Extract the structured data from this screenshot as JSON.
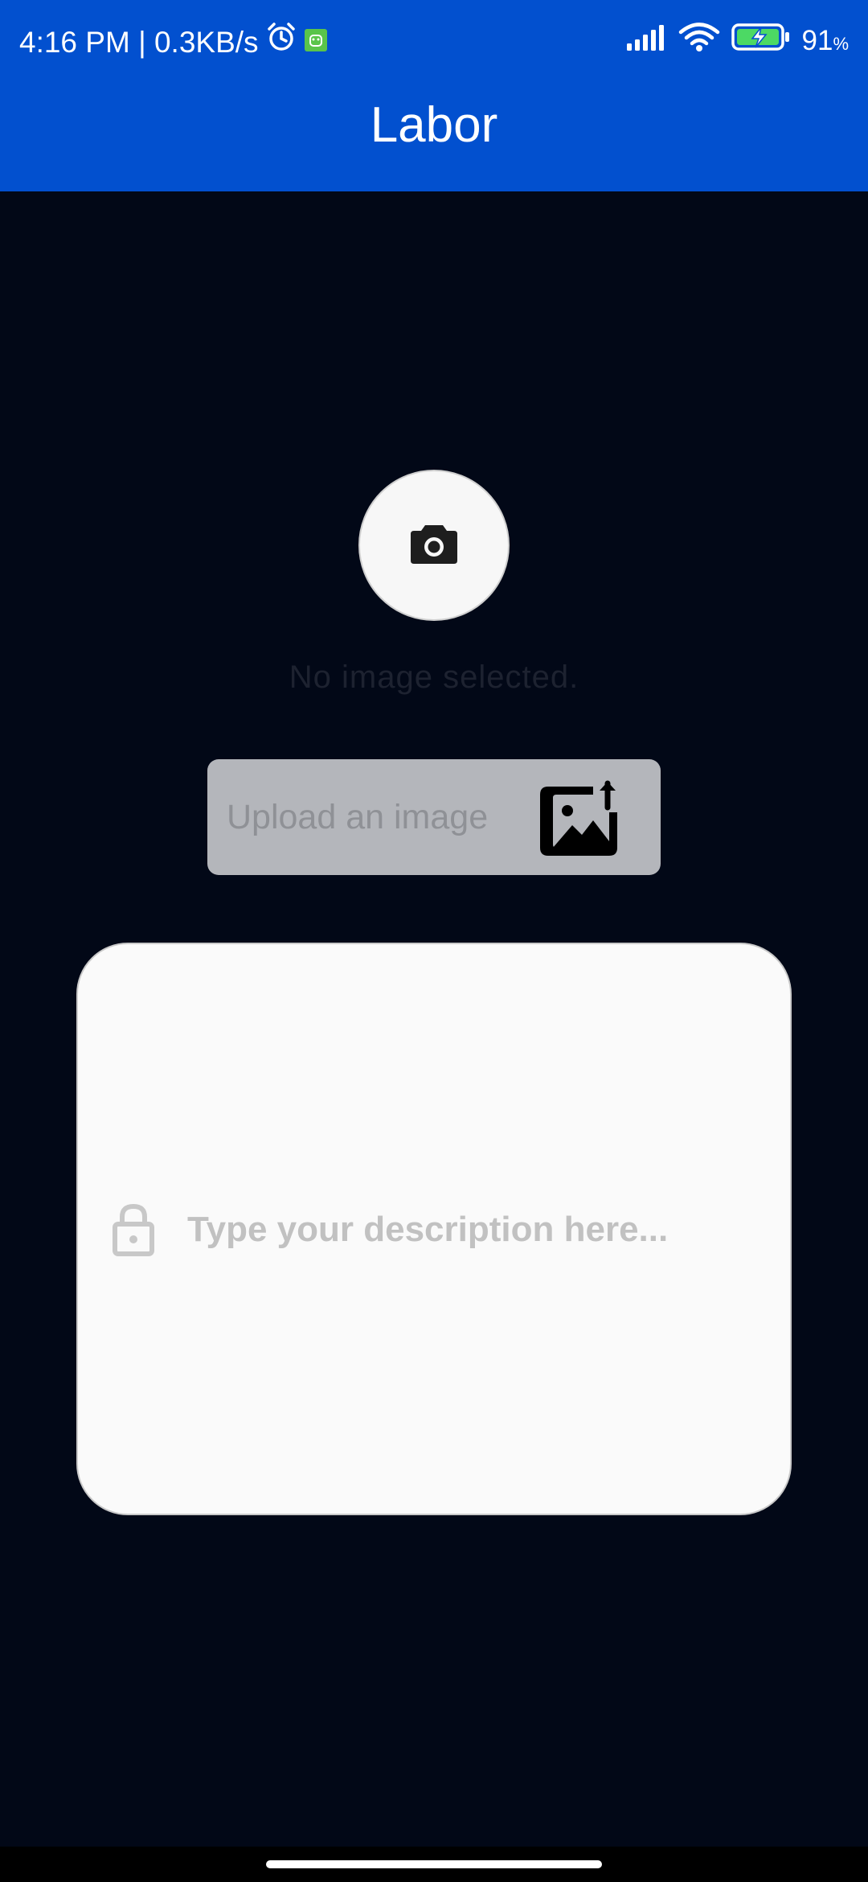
{
  "status_bar": {
    "time_speed": "4:16 PM | 0.3KB/s",
    "battery_percent": "91",
    "battery_unit": "%",
    "icons": [
      "alarm-icon",
      "app-notification-icon",
      "signal-icon",
      "wifi-icon",
      "battery-charging-icon"
    ]
  },
  "header": {
    "title": "Labor"
  },
  "main": {
    "camera_icon": "camera-icon",
    "no_image_text": "No image selected.",
    "upload_label": "Upload an image",
    "upload_icon": "image-upload-icon",
    "description": {
      "placeholder": "Type your description here...",
      "value": "",
      "icon": "lock-icon"
    }
  },
  "colors": {
    "header_bg": "#0250cf",
    "page_bg": "#020817",
    "upload_bg": "#b4b6bb",
    "card_bg": "#fafafa"
  }
}
